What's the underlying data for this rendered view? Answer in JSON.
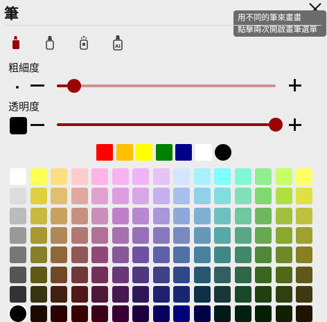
{
  "header": {
    "title": "筆"
  },
  "tooltip": {
    "line1": "用不同的筆來畫畫",
    "line2": "點擊兩次開啟畫筆選單"
  },
  "tools": [
    {
      "name": "marker-icon",
      "active": true
    },
    {
      "name": "pen-icon",
      "active": false
    },
    {
      "name": "spray-icon",
      "active": false
    },
    {
      "name": "ai-pen-icon",
      "active": false
    }
  ],
  "thickness": {
    "label": "粗細度",
    "value": 0.08
  },
  "opacity": {
    "label": "透明度",
    "value": 1.0
  },
  "colors": {
    "accent": "#9a0000",
    "quick": [
      "#ff0000",
      "#ffc000",
      "#ffff00",
      "#008000",
      "#00008b",
      "#ffffff",
      "#000000"
    ],
    "selected": "#000000",
    "grid": [
      [
        "#ffffff",
        "#ffff55",
        "#ffdd80",
        "#ffcccc",
        "#ffb3e6",
        "#f7b3f0",
        "#f0b3f5",
        "#e6c3f7",
        "#d5e4ff",
        "#a8f0ff",
        "#80ffff",
        "#80f7d5",
        "#90ee90",
        "#c6ff66",
        "#ffff66"
      ],
      [
        "#dcdcdc",
        "#e0d040",
        "#e0c070",
        "#e0a8a0",
        "#e0a0d0",
        "#dc9ee0",
        "#d8a8e6",
        "#c8b0f0",
        "#a8c0f0",
        "#90d0e8",
        "#80dde0",
        "#80e0b8",
        "#80d870",
        "#b0e040",
        "#e0e040"
      ],
      [
        "#bbbbbb",
        "#c8b840",
        "#c8a060",
        "#c89080",
        "#c890b8",
        "#c080c8",
        "#b888d0",
        "#a898d8",
        "#90a8d8",
        "#80b0d0",
        "#70c0c0",
        "#70c8a0",
        "#70b860",
        "#a0c040",
        "#c0c040"
      ],
      [
        "#999999",
        "#a89830",
        "#b08858",
        "#b07870",
        "#b07098",
        "#a870b0",
        "#9870b8",
        "#8878c0",
        "#7888c0",
        "#6898b8",
        "#58a8a8",
        "#58a888",
        "#68a850",
        "#88a830",
        "#a0a030"
      ],
      [
        "#777777",
        "#888028",
        "#906838",
        "#905858",
        "#904878",
        "#885898",
        "#7050a0",
        "#6060a8",
        "#5070a8",
        "#4880a0",
        "#408888",
        "#408868",
        "#508838",
        "#708828",
        "#888020"
      ],
      [
        "#555555",
        "#605818",
        "#704828",
        "#703838",
        "#703058",
        "#683878",
        "#503880",
        "#404088",
        "#304888",
        "#285870",
        "#306060",
        "#2e6848",
        "#386820",
        "#506818",
        "#605818"
      ],
      [
        "#333333",
        "#383310",
        "#402010",
        "#501818",
        "#501838",
        "#481850",
        "#301858",
        "#202070",
        "#182870",
        "#103048",
        "#183838",
        "#184828",
        "#204010",
        "#304010",
        "#403810"
      ],
      [
        "#111111",
        "#1a0a00",
        "#2a0000",
        "#3a0000",
        "#3a0018",
        "#360036",
        "#1e003e",
        "#0a0060",
        "#00007a",
        "#000044",
        "#001a1a",
        "#002010",
        "#002000",
        "#102000",
        "#201400"
      ]
    ]
  }
}
